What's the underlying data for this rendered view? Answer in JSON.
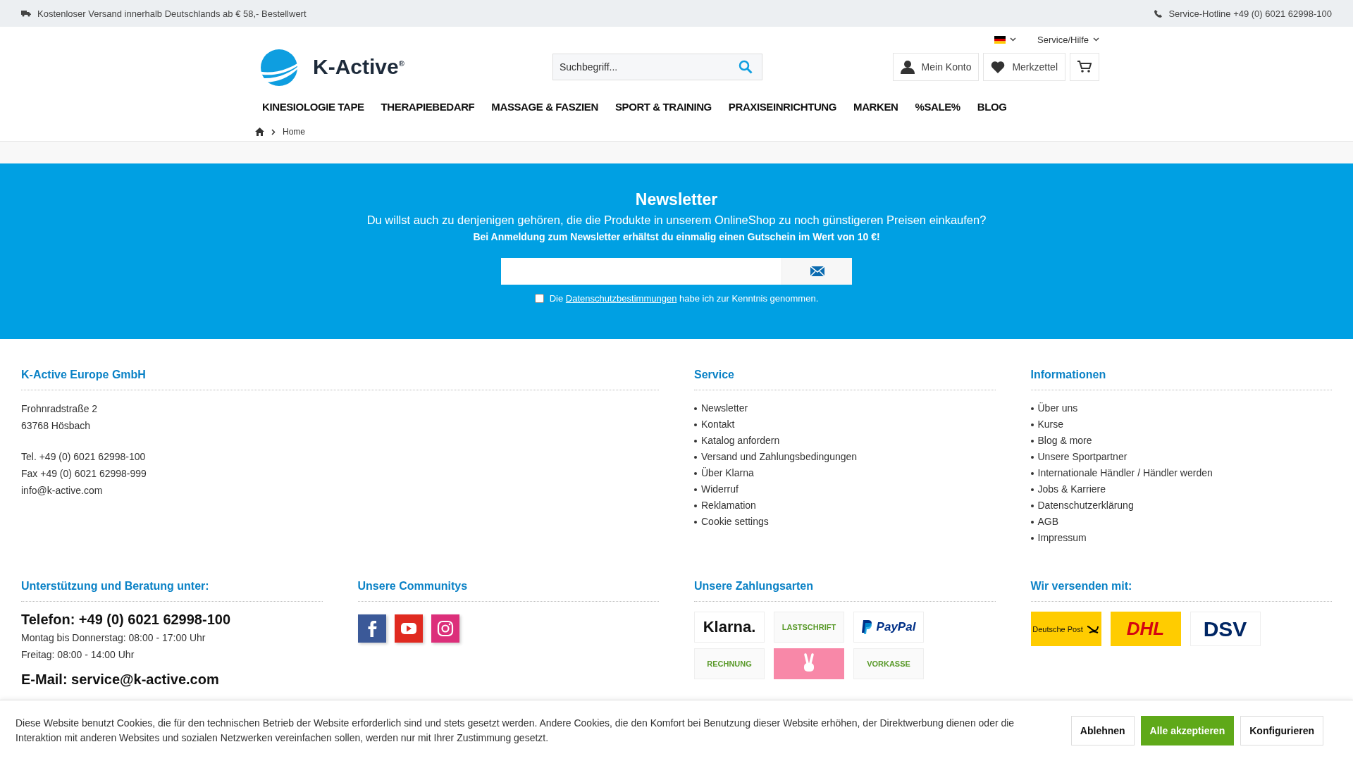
{
  "top_bar": {
    "shipping_note": "Kostenloser Versand innerhalb Deutschlands ab € 58,- Bestellwert",
    "hotline": "Service-Hotline +49 (0) 6021 62998-100"
  },
  "header": {
    "logo_text": "K-Active",
    "logo_mark": "®",
    "service_menu": "Service/Hilfe",
    "search": {
      "placeholder": "Suchbegriff..."
    },
    "account": "Mein Konto",
    "wishlist": "Merkzettel"
  },
  "nav": [
    "KINESIOLOGIE TAPE",
    "THERAPIEBEDARF",
    "MASSAGE & FASZIEN",
    "SPORT & TRAINING",
    "PRAXISEINRICHTUNG",
    "MARKEN",
    "%SALE%",
    "BLOG"
  ],
  "breadcrumb": [
    "Home"
  ],
  "newsletter": {
    "title": "Newsletter",
    "text": "Du willst auch zu denjenigen gehören, die die Produkte in unserem OnlineShop zu noch günstigeren Preisen einkaufen?",
    "bonus": "Bei Anmeldung zum Newsletter erhältst du einmalig einen Gutschein im Wert von 10 €!",
    "consent": {
      "checked": false,
      "before": "Die",
      "link": "Datenschutzbestimmungen",
      "after": "habe ich zur Kenntnis genommen."
    }
  },
  "company": {
    "heading": "K-Active Europe GmbH",
    "address": [
      "Frohnradstraße 2",
      "63768 Hösbach"
    ],
    "contact": [
      "Tel. +49 (0) 6021 62998-100",
      "Fax +49 (0) 6021 62998-999",
      "info@k-active.com"
    ]
  },
  "service": {
    "heading": "Service",
    "links": [
      "Newsletter",
      "Kontakt",
      "Katalog anfordern",
      "Versand und Zahlungsbedingungen",
      "Über Klarna",
      "Widerruf",
      "Reklamation",
      "Cookie settings"
    ]
  },
  "informationen": {
    "heading": "Informationen",
    "links": [
      "Über uns",
      "Kurse",
      "Blog & more",
      "Unsere Sportpartner",
      "Internationale Händler / Händler werden",
      "Jobs & Karriere",
      "Datenschutzerklärung",
      "AGB",
      "Impressum"
    ]
  },
  "support": {
    "heading": "Unterstützung und Beratung unter:",
    "phone": "Telefon: +49 (0) 6021 62998-100",
    "hours": [
      "Montag bis Donnerstag: 08:00 - 17:00 Uhr",
      "Freitag: 08:00 - 14:00 Uhr"
    ],
    "email": "E-Mail: service@k-active.com"
  },
  "communities": {
    "heading": "Unsere Communitys",
    "networks": [
      {
        "kind": "facebook"
      },
      {
        "kind": "youtube"
      },
      {
        "kind": "instagram"
      }
    ]
  },
  "payments": {
    "heading": "Unsere Zahlungsarten",
    "methods": [
      {
        "kind": "klarna",
        "label": "Klarna."
      },
      {
        "kind": "stamp",
        "label": "LASTSCHRIFT"
      },
      {
        "kind": "paypal",
        "label": "PayPal"
      },
      {
        "kind": "stamp",
        "label": "RECHNUNG"
      },
      {
        "kind": "victory"
      },
      {
        "kind": "stamp",
        "label": "VORKASSE"
      }
    ]
  },
  "shipping": {
    "heading": "Wir versenden mit:",
    "carriers": [
      {
        "kind": "post",
        "label": "Deutsche Post"
      },
      {
        "kind": "dhl",
        "label": "DHL"
      },
      {
        "kind": "dsv",
        "label": "DSV"
      }
    ]
  },
  "cookie": {
    "text": "Diese Website benutzt Cookies, die für den technischen Betrieb der Website erforderlich sind und stets gesetzt werden. Andere Cookies, die den Komfort bei Benutzung dieser Website erhöhen, der Direktwerbung dienen oder die Interaktion mit anderen Websites und sozialen Netzwerken vereinfachen sollen, werden nur mit Ihrer Zustimmung gesetzt.",
    "buttons": [
      {
        "kind": "plain",
        "label": "Ablehnen"
      },
      {
        "kind": "primary",
        "label": "Alle akzeptieren"
      },
      {
        "kind": "plain",
        "label": "Konfigurieren"
      }
    ]
  }
}
